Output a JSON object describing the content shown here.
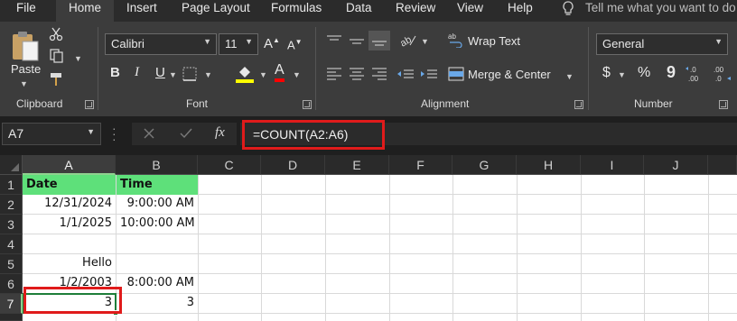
{
  "menu": {
    "tabs": [
      "File",
      "Home",
      "Insert",
      "Page Layout",
      "Formulas",
      "Data",
      "Review",
      "View",
      "Help"
    ],
    "active": "Home",
    "tell_me": "Tell me what you want to do"
  },
  "ribbon": {
    "clipboard": {
      "paste_label": "Paste",
      "group_label": "Clipboard"
    },
    "font": {
      "name": "Calibri",
      "size": "11",
      "bold": "B",
      "italic": "I",
      "underline": "U",
      "group_label": "Font",
      "fill_color": "#ffff00",
      "font_color": "#ff0000"
    },
    "alignment": {
      "wrap_text": "Wrap Text",
      "merge_center": "Merge & Center",
      "group_label": "Alignment"
    },
    "number": {
      "format": "General",
      "currency": "$",
      "percent": "%",
      "comma": "9",
      "group_label": "Number"
    }
  },
  "formula_bar": {
    "name_box": "A7",
    "fx": "fx",
    "formula": "=COUNT(A2:A6)",
    "highlight_color": "#e01b1b"
  },
  "sheet": {
    "columns": [
      "A",
      "B",
      "C",
      "D",
      "E",
      "F",
      "G",
      "H",
      "I",
      "J"
    ],
    "rows": [
      "1",
      "2",
      "3",
      "4",
      "5",
      "6",
      "7"
    ],
    "selected_cell": "A7",
    "header_fill": "#5ee07a",
    "cells": {
      "A1": "Date",
      "B1": "Time",
      "A2": "12/31/2024",
      "B2": "9:00:00 AM",
      "A3": "1/1/2025",
      "B3": "10:00:00 AM",
      "A5": "Hello",
      "A6": "1/2/2003",
      "B6": "8:00:00 AM",
      "A7": "3",
      "B7": "3"
    }
  }
}
